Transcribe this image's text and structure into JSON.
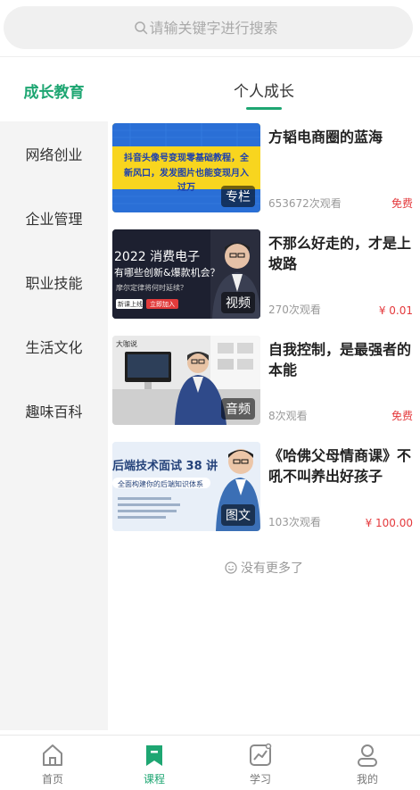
{
  "search": {
    "placeholder": "请输关键字进行搜索"
  },
  "category_header": {
    "left_active": "成长教育",
    "right_tab": "个人成长"
  },
  "sidebar": {
    "items": [
      "网络创业",
      "企业管理",
      "职业技能",
      "生活文化",
      "趣味百科"
    ]
  },
  "courses": [
    {
      "title": "方韬电商圈的蓝海",
      "badge": "专栏",
      "views": "653672次观看",
      "price": "免费",
      "thumb_text_1": "抖音头像号变现零基础教程，全",
      "thumb_text_2": "新风口，发发图片也能变现月入",
      "thumb_text_3": "过万"
    },
    {
      "title": "不那么好走的，才是上坡路",
      "badge": "视频",
      "views": "270次观看",
      "price": "¥ 0.01",
      "thumb_text_1": "2022 消费电子",
      "thumb_text_2": "有哪些创新&爆款机会？",
      "thumb_text_3": "摩尔定律将何时延续？",
      "thumb_text_4": "新课上线",
      "thumb_text_5": "立即加入"
    },
    {
      "title": "自我控制，是最强者的本能",
      "badge": "音频",
      "views": "8次观看",
      "price": "免费",
      "thumb_text_1": "大咖说"
    },
    {
      "title": "《哈佛父母情商课》不吼不叫养出好孩子",
      "badge": "图文",
      "views": "103次观看",
      "price": "¥ 100.00",
      "thumb_text_1": "后端技术面试 38 讲",
      "thumb_text_2": "全面构建你的后端知识体系"
    }
  ],
  "footer_note": "没有更多了",
  "tabbar": {
    "items": [
      {
        "label": "首页",
        "icon": "home-icon"
      },
      {
        "label": "课程",
        "icon": "bookmark-icon"
      },
      {
        "label": "学习",
        "icon": "chart-icon"
      },
      {
        "label": "我的",
        "icon": "user-icon"
      }
    ],
    "active": "课程"
  },
  "colors": {
    "accent": "#1ea672",
    "price_red": "#e4393c"
  }
}
